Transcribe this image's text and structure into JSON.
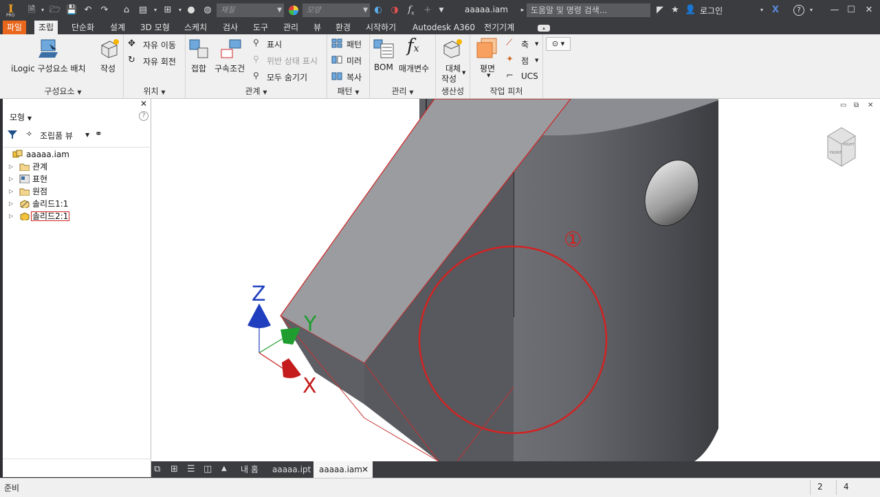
{
  "titlebar": {
    "material_placeholder": "재질",
    "appearance_placeholder": "모양",
    "document_title": "aaaaa.iam",
    "search_placeholder": "도움말 및 명령 검색...",
    "login_label": "로그인",
    "app_badge": "PRO"
  },
  "tabs": [
    {
      "label": "파일"
    },
    {
      "label": "조립"
    },
    {
      "label": "단순화"
    },
    {
      "label": "설계"
    },
    {
      "label": "3D 모형"
    },
    {
      "label": "스케치"
    },
    {
      "label": "검사"
    },
    {
      "label": "도구"
    },
    {
      "label": "관리"
    },
    {
      "label": "뷰"
    },
    {
      "label": "환경"
    },
    {
      "label": "시작하기"
    },
    {
      "label": "Autodesk A360"
    },
    {
      "label": "전기기계"
    }
  ],
  "ribbon": {
    "component": {
      "title": "구성요소",
      "place_ilogic": "iLogic 구성요소 배치",
      "create": "작성"
    },
    "position": {
      "title": "위치",
      "free_move": "자유 이동",
      "free_rotate": "자유 회전"
    },
    "relationships": {
      "title": "관계",
      "joint": "접합",
      "constrain": "구속조건",
      "show": "표시",
      "show_sick": "위반 상태 표시",
      "hide_all": "모두 숨기기"
    },
    "pattern": {
      "title": "패턴",
      "pattern": "패턴",
      "mirror": "미러",
      "copy": "복사"
    },
    "manage": {
      "title": "관리",
      "bom": "BOM",
      "parameters": "매개변수"
    },
    "productivity": {
      "title": "생산성",
      "substitute_line1": "대체",
      "substitute_line2": "작성"
    },
    "work_features": {
      "title": "작업 피처",
      "plane": "평면",
      "axis": "축",
      "point": "점",
      "ucs": "UCS"
    }
  },
  "browser": {
    "title": "모형",
    "view_label": "조립품 뷰",
    "help": "?",
    "tree": [
      {
        "label": "aaaaa.iam",
        "icon": "assembly-icon"
      },
      {
        "label": "관계",
        "icon": "folder-icon"
      },
      {
        "label": "표현",
        "icon": "representations-icon"
      },
      {
        "label": "원점",
        "icon": "folder-icon"
      },
      {
        "label": "솔리드1:1",
        "icon": "part-icon"
      },
      {
        "label": "솔리드2:1",
        "icon": "part-icon",
        "selected": true
      }
    ]
  },
  "viewport": {
    "triad_z": "Z",
    "triad_y": "Y",
    "triad_x": "X",
    "annotation": "①",
    "viewcube_face_front": "FRONT",
    "viewcube_face_right": "RIGHT"
  },
  "doc_tabs": {
    "home": "내 홈",
    "tab1": "aaaaa.ipt",
    "tab2": "aaaaa.iam"
  },
  "status": {
    "text": "준비",
    "count1": "2",
    "count2": "4"
  },
  "colors": {
    "file_tab": "#e8671c",
    "highlight_red": "#d22222",
    "triad_z": "#1f3fbf",
    "triad_y": "#1f9e2f",
    "triad_x": "#c41c1c"
  }
}
